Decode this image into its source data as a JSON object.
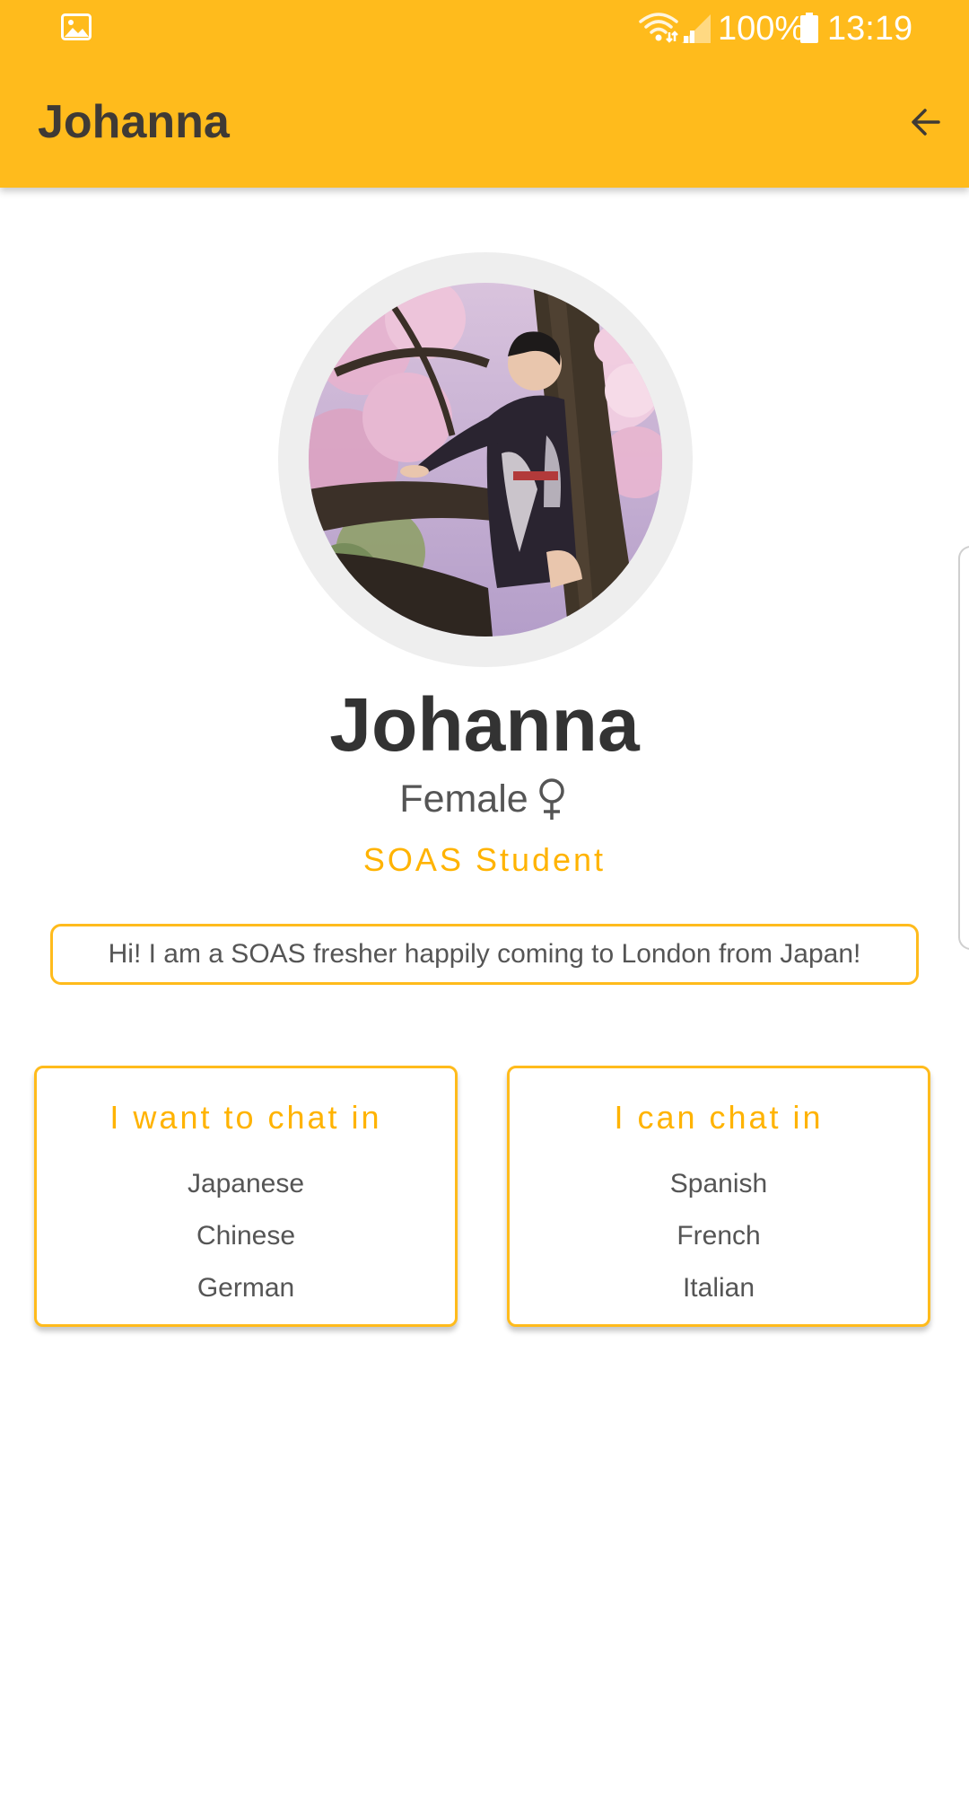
{
  "status_bar": {
    "battery_percent": "100%",
    "time": "13:19",
    "icons": [
      "gallery-icon",
      "wifi-icon",
      "signal-icon",
      "battery-icon"
    ]
  },
  "app_bar": {
    "title": "Johanna",
    "back_icon": "arrow-left-icon",
    "background_color": "#FFBB1C"
  },
  "profile": {
    "name": "Johanna",
    "gender": "Female",
    "gender_icon": "female-symbol-icon",
    "role": "SOAS Student",
    "bio": "Hi! I am a SOAS fresher happily coming to London from Japan!"
  },
  "cards": {
    "want": {
      "title": "I want to chat in",
      "languages": [
        "Japanese",
        "Chinese",
        "German"
      ]
    },
    "can": {
      "title": "I can chat in",
      "languages": [
        "Spanish",
        "French",
        "Italian"
      ]
    }
  },
  "colors": {
    "accent": "#FFBB1C",
    "accent_text": "#FFB300",
    "title_text": "#3f3a35",
    "body_text": "#555555"
  }
}
